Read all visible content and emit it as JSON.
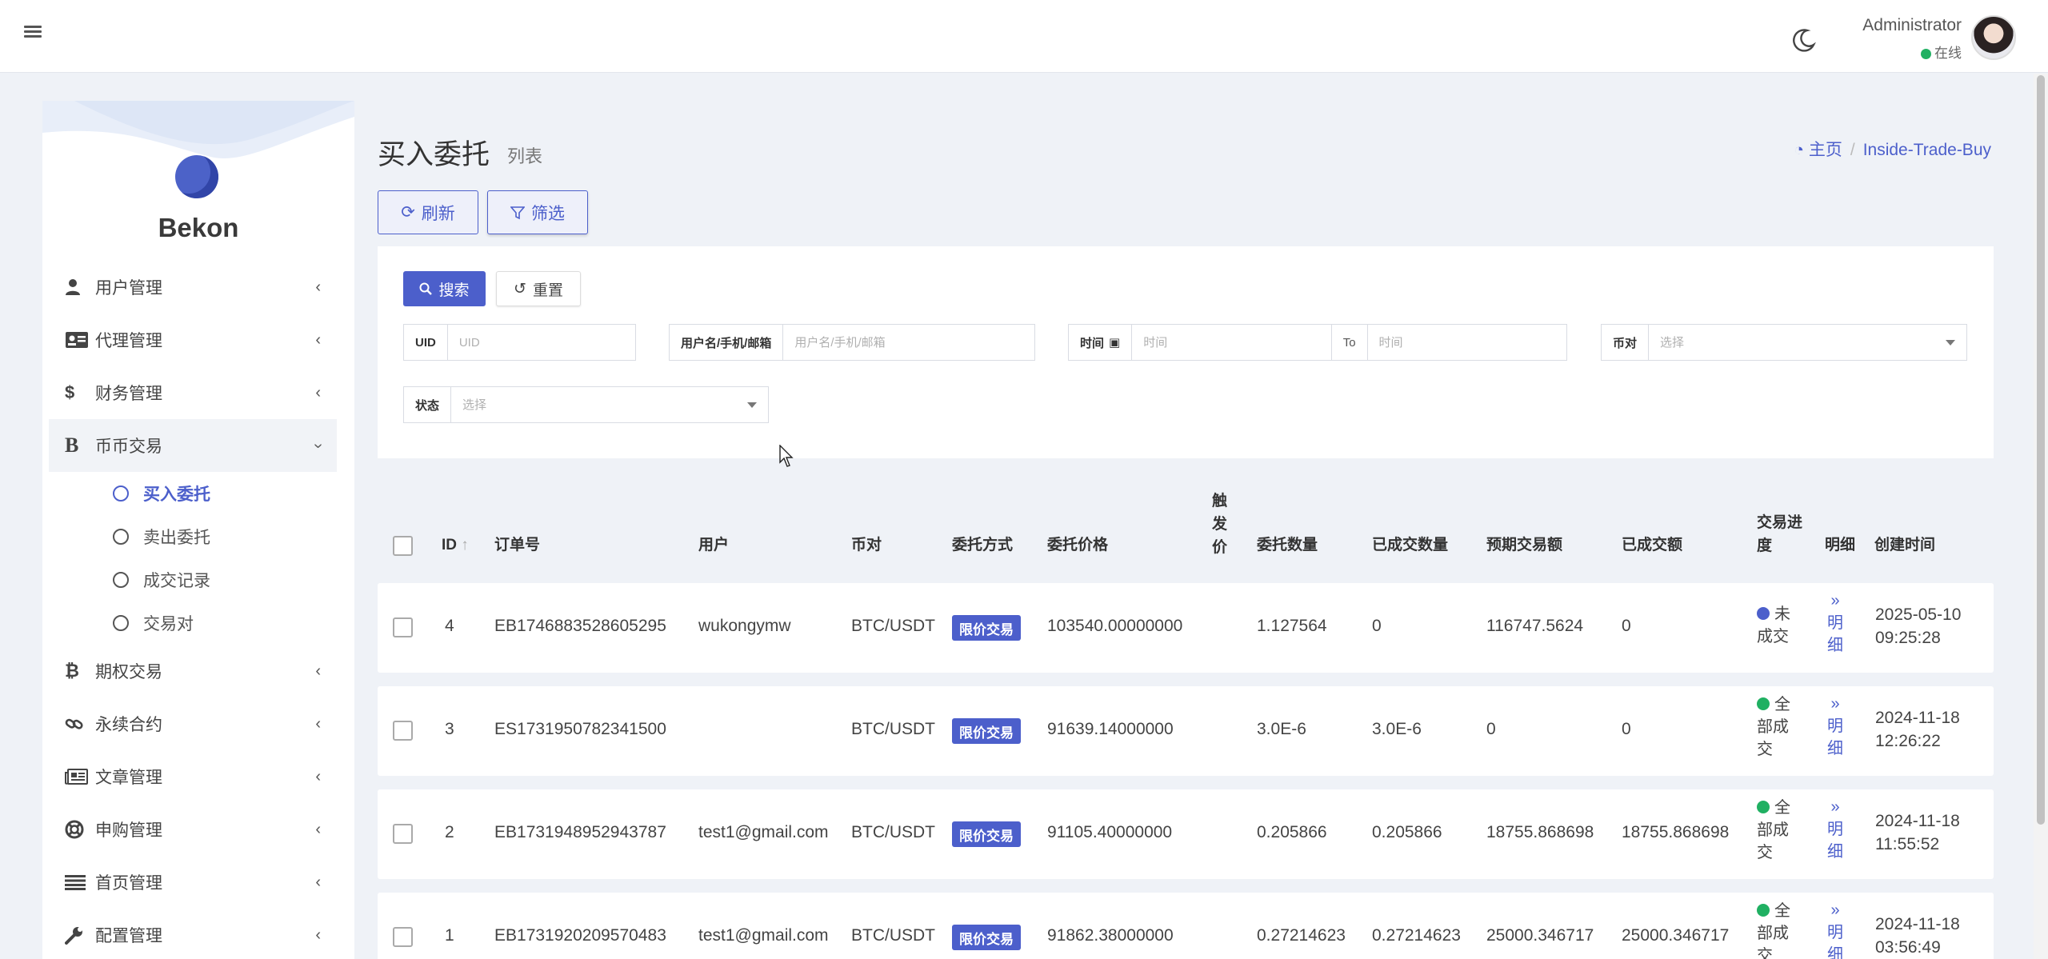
{
  "header": {
    "user_name": "Administrator",
    "user_status": "在线"
  },
  "sidebar": {
    "brand": "Bekon",
    "items": [
      {
        "label": "用户管理"
      },
      {
        "label": "代理管理"
      },
      {
        "label": "财务管理"
      },
      {
        "label": "币币交易"
      },
      {
        "label": "期权交易"
      },
      {
        "label": "永续合约"
      },
      {
        "label": "文章管理"
      },
      {
        "label": "申购管理"
      },
      {
        "label": "首页管理"
      },
      {
        "label": "配置管理"
      }
    ],
    "subitems": [
      {
        "label": "买入委托"
      },
      {
        "label": "卖出委托"
      },
      {
        "label": "成交记录"
      },
      {
        "label": "交易对"
      }
    ]
  },
  "page": {
    "title": "买入委托",
    "subtitle": "列表",
    "breadcrumb_home": "主页",
    "breadcrumb_current": "Inside-Trade-Buy",
    "refresh_label": "刷新",
    "filter_label": "筛选"
  },
  "search": {
    "search_label": "搜索",
    "reset_label": "重置",
    "uid_label": "UID",
    "uid_placeholder": "UID",
    "user_label": "用户名/手机/邮箱",
    "user_placeholder": "用户名/手机/邮箱",
    "time_label": "时间",
    "time_placeholder": "时间",
    "to_label": "To",
    "pair_label": "币对",
    "pair_placeholder": "选择",
    "status_label": "状态",
    "status_placeholder": "选择"
  },
  "table": {
    "headers": {
      "id": "ID",
      "order_no": "订单号",
      "user": "用户",
      "pair": "币对",
      "method": "委托方式",
      "price": "委托价格",
      "trigger": "触发价",
      "qty": "委托数量",
      "filled_qty": "已成交数量",
      "expected_amount": "预期交易额",
      "filled_amount": "已成交额",
      "progress": "交易进度",
      "detail": "明细",
      "created": "创建时间"
    },
    "rows": [
      {
        "id": "4",
        "order_no": "EB1746883528605295",
        "user": "wukongymw",
        "pair": "BTC/USDT",
        "method": "限价交易",
        "price": "103540.00000000",
        "trigger": "",
        "qty": "1.127564",
        "filled_qty": "0",
        "expected_amount": "116747.5624",
        "filled_amount": "0",
        "progress": "未成交",
        "progress_color": "#4c5fcb",
        "detail": "» 明细",
        "date": "2025-05-10",
        "time": "09:25:28"
      },
      {
        "id": "3",
        "order_no": "ES1731950782341500",
        "user": "",
        "pair": "BTC/USDT",
        "method": "限价交易",
        "price": "91639.14000000",
        "trigger": "",
        "qty": "3.0E-6",
        "filled_qty": "3.0E-6",
        "expected_amount": "0",
        "filled_amount": "0",
        "progress": "全部成交",
        "progress_color": "#20b062",
        "detail": "» 明细",
        "date": "2024-11-18",
        "time": "12:26:22"
      },
      {
        "id": "2",
        "order_no": "EB1731948952943787",
        "user": "test1@gmail.com",
        "pair": "BTC/USDT",
        "method": "限价交易",
        "price": "91105.40000000",
        "trigger": "",
        "qty": "0.205866",
        "filled_qty": "0.205866",
        "expected_amount": "18755.868698",
        "filled_amount": "18755.868698",
        "progress": "全部成交",
        "progress_color": "#20b062",
        "detail": "» 明细",
        "date": "2024-11-18",
        "time": "11:55:52"
      },
      {
        "id": "1",
        "order_no": "EB1731920209570483",
        "user": "test1@gmail.com",
        "pair": "BTC/USDT",
        "method": "限价交易",
        "price": "91862.38000000",
        "trigger": "",
        "qty": "0.27214623",
        "filled_qty": "0.27214623",
        "expected_amount": "25000.346717",
        "filled_amount": "25000.346717",
        "progress": "全部成交",
        "progress_color": "#20b062",
        "detail": "» 明细",
        "date": "2024-11-18",
        "time": "03:56:49"
      }
    ]
  }
}
